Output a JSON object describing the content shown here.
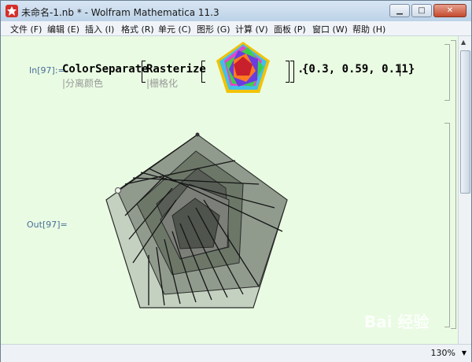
{
  "window": {
    "title": "未命名-1.nb * - Wolfram Mathematica 11.3",
    "min_icon": "minimize-icon",
    "max_icon": "maximize-icon",
    "close_icon": "close-icon"
  },
  "menu": [
    "文件 (F)",
    "编辑 (E)",
    "插入 (I)",
    "格式 (R)",
    "单元 (C)",
    "图形 (G)",
    "计算 (V)",
    "面板 (P)",
    "窗口 (W)",
    "帮助 (H)"
  ],
  "notebook": {
    "in_label": "In[97]:=",
    "out_label": "Out[97]=",
    "func1": "ColorSeparate",
    "func1_hint": "|分离颜色",
    "func2": "Rasterize",
    "func2_hint": "|栅格化",
    "dot": ".",
    "vector": "{0.3, 0.59, 0.11}"
  },
  "status": {
    "zoom": "130%"
  },
  "watermark": "Bai 经验",
  "colors": {
    "accent": "#4a6f9a",
    "background": "#e9fbe2"
  }
}
